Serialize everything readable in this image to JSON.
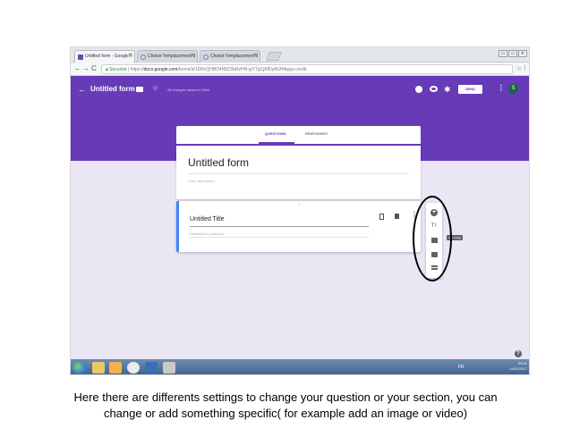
{
  "browser": {
    "tabs": [
      {
        "label": "Untitled form - Google F"
      },
      {
        "label": "Choisir l'emplacement d"
      },
      {
        "label": "Choisir l'emplacement d"
      }
    ],
    "tab_close": "×",
    "url_secure": "Sécurisé",
    "url_prefix": "https://",
    "url_domain": "docs.google.com",
    "url_path": "/forms/d/1DRcQHBD4N5C0kRzHN-yjYTgCjKfDy8GHlbpgu-c/edit",
    "nav": {
      "back": "←",
      "forward": "→",
      "reload": "C"
    },
    "star": "☆",
    "menu": "⋮",
    "window_controls": [
      "▭",
      "▭",
      "✕"
    ]
  },
  "forms_header": {
    "back": "←",
    "title": "Untitled form",
    "star": "☆",
    "saved_status": "All changes saved in Drive",
    "gear": "✱",
    "send_label": "SEND",
    "more": "⋮",
    "avatar_letter": "S",
    "accent": "#673ab7"
  },
  "form_tabs": {
    "questions": "QUESTIONS",
    "responses": "RESPONSES"
  },
  "title_card": {
    "title": "Untitled form",
    "description_placeholder": "Form description"
  },
  "question_card": {
    "drag_handle": "⠿",
    "title": "Untitled Title",
    "description_placeholder": "Description (optional)",
    "more": "⋮"
  },
  "toolbar": {
    "add_question": "+",
    "add_title": "Tт",
    "image_tooltip": "Add image"
  },
  "help": "?",
  "taskbar": {
    "time": "09:21",
    "date": "14/11/2017",
    "language": "FR"
  },
  "caption": {
    "line1": "Here there are differents settings to change your question or your section, you can",
    "line2": "change or add something specific( for example add an image or video)"
  }
}
